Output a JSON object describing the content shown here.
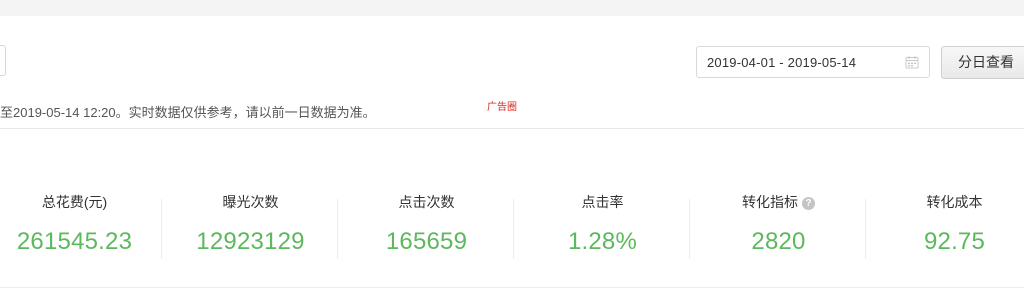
{
  "toolbar": {
    "date_range": "2019-04-01 - 2019-05-14",
    "day_view_button": "分日查看"
  },
  "notice": {
    "text": "至2019-05-14 12:20。实时数据仅供参考，请以前一日数据为准。",
    "ad_tag": "广告圈"
  },
  "metrics": [
    {
      "label": "总花费(元)",
      "value": "261545.23"
    },
    {
      "label": "曝光次数",
      "value": "12923129"
    },
    {
      "label": "点击次数",
      "value": "165659"
    },
    {
      "label": "点击率",
      "value": "1.28%"
    },
    {
      "label": "转化指标",
      "value": "2820",
      "help_icon": "question-circle-icon",
      "help_glyph": "?"
    },
    {
      "label": "转化成本",
      "value": "92.75"
    }
  ],
  "colors": {
    "metric_value": "#5cb85c",
    "ad_tag": "#d9281e"
  }
}
